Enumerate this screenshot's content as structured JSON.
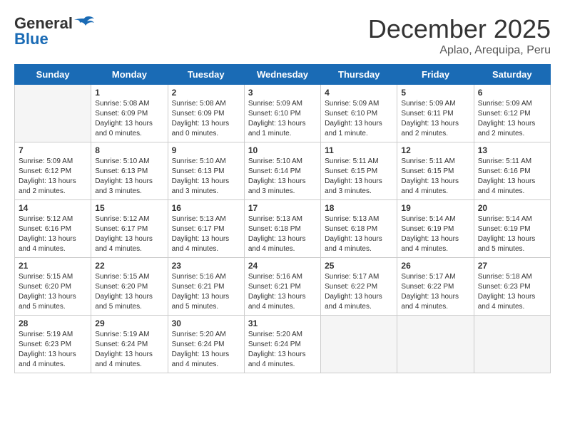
{
  "header": {
    "logo_general": "General",
    "logo_blue": "Blue",
    "month": "December 2025",
    "location": "Aplao, Arequipa, Peru"
  },
  "days_of_week": [
    "Sunday",
    "Monday",
    "Tuesday",
    "Wednesday",
    "Thursday",
    "Friday",
    "Saturday"
  ],
  "weeks": [
    [
      {
        "day": "",
        "sunrise": "",
        "sunset": "",
        "daylight": "",
        "empty": true
      },
      {
        "day": "1",
        "sunrise": "Sunrise: 5:08 AM",
        "sunset": "Sunset: 6:09 PM",
        "daylight": "Daylight: 13 hours and 0 minutes."
      },
      {
        "day": "2",
        "sunrise": "Sunrise: 5:08 AM",
        "sunset": "Sunset: 6:09 PM",
        "daylight": "Daylight: 13 hours and 0 minutes."
      },
      {
        "day": "3",
        "sunrise": "Sunrise: 5:09 AM",
        "sunset": "Sunset: 6:10 PM",
        "daylight": "Daylight: 13 hours and 1 minute."
      },
      {
        "day": "4",
        "sunrise": "Sunrise: 5:09 AM",
        "sunset": "Sunset: 6:10 PM",
        "daylight": "Daylight: 13 hours and 1 minute."
      },
      {
        "day": "5",
        "sunrise": "Sunrise: 5:09 AM",
        "sunset": "Sunset: 6:11 PM",
        "daylight": "Daylight: 13 hours and 2 minutes."
      },
      {
        "day": "6",
        "sunrise": "Sunrise: 5:09 AM",
        "sunset": "Sunset: 6:12 PM",
        "daylight": "Daylight: 13 hours and 2 minutes."
      }
    ],
    [
      {
        "day": "7",
        "sunrise": "Sunrise: 5:09 AM",
        "sunset": "Sunset: 6:12 PM",
        "daylight": "Daylight: 13 hours and 2 minutes."
      },
      {
        "day": "8",
        "sunrise": "Sunrise: 5:10 AM",
        "sunset": "Sunset: 6:13 PM",
        "daylight": "Daylight: 13 hours and 3 minutes."
      },
      {
        "day": "9",
        "sunrise": "Sunrise: 5:10 AM",
        "sunset": "Sunset: 6:13 PM",
        "daylight": "Daylight: 13 hours and 3 minutes."
      },
      {
        "day": "10",
        "sunrise": "Sunrise: 5:10 AM",
        "sunset": "Sunset: 6:14 PM",
        "daylight": "Daylight: 13 hours and 3 minutes."
      },
      {
        "day": "11",
        "sunrise": "Sunrise: 5:11 AM",
        "sunset": "Sunset: 6:15 PM",
        "daylight": "Daylight: 13 hours and 3 minutes."
      },
      {
        "day": "12",
        "sunrise": "Sunrise: 5:11 AM",
        "sunset": "Sunset: 6:15 PM",
        "daylight": "Daylight: 13 hours and 4 minutes."
      },
      {
        "day": "13",
        "sunrise": "Sunrise: 5:11 AM",
        "sunset": "Sunset: 6:16 PM",
        "daylight": "Daylight: 13 hours and 4 minutes."
      }
    ],
    [
      {
        "day": "14",
        "sunrise": "Sunrise: 5:12 AM",
        "sunset": "Sunset: 6:16 PM",
        "daylight": "Daylight: 13 hours and 4 minutes."
      },
      {
        "day": "15",
        "sunrise": "Sunrise: 5:12 AM",
        "sunset": "Sunset: 6:17 PM",
        "daylight": "Daylight: 13 hours and 4 minutes."
      },
      {
        "day": "16",
        "sunrise": "Sunrise: 5:13 AM",
        "sunset": "Sunset: 6:17 PM",
        "daylight": "Daylight: 13 hours and 4 minutes."
      },
      {
        "day": "17",
        "sunrise": "Sunrise: 5:13 AM",
        "sunset": "Sunset: 6:18 PM",
        "daylight": "Daylight: 13 hours and 4 minutes."
      },
      {
        "day": "18",
        "sunrise": "Sunrise: 5:13 AM",
        "sunset": "Sunset: 6:18 PM",
        "daylight": "Daylight: 13 hours and 4 minutes."
      },
      {
        "day": "19",
        "sunrise": "Sunrise: 5:14 AM",
        "sunset": "Sunset: 6:19 PM",
        "daylight": "Daylight: 13 hours and 4 minutes."
      },
      {
        "day": "20",
        "sunrise": "Sunrise: 5:14 AM",
        "sunset": "Sunset: 6:19 PM",
        "daylight": "Daylight: 13 hours and 5 minutes."
      }
    ],
    [
      {
        "day": "21",
        "sunrise": "Sunrise: 5:15 AM",
        "sunset": "Sunset: 6:20 PM",
        "daylight": "Daylight: 13 hours and 5 minutes."
      },
      {
        "day": "22",
        "sunrise": "Sunrise: 5:15 AM",
        "sunset": "Sunset: 6:20 PM",
        "daylight": "Daylight: 13 hours and 5 minutes."
      },
      {
        "day": "23",
        "sunrise": "Sunrise: 5:16 AM",
        "sunset": "Sunset: 6:21 PM",
        "daylight": "Daylight: 13 hours and 5 minutes."
      },
      {
        "day": "24",
        "sunrise": "Sunrise: 5:16 AM",
        "sunset": "Sunset: 6:21 PM",
        "daylight": "Daylight: 13 hours and 4 minutes."
      },
      {
        "day": "25",
        "sunrise": "Sunrise: 5:17 AM",
        "sunset": "Sunset: 6:22 PM",
        "daylight": "Daylight: 13 hours and 4 minutes."
      },
      {
        "day": "26",
        "sunrise": "Sunrise: 5:17 AM",
        "sunset": "Sunset: 6:22 PM",
        "daylight": "Daylight: 13 hours and 4 minutes."
      },
      {
        "day": "27",
        "sunrise": "Sunrise: 5:18 AM",
        "sunset": "Sunset: 6:23 PM",
        "daylight": "Daylight: 13 hours and 4 minutes."
      }
    ],
    [
      {
        "day": "28",
        "sunrise": "Sunrise: 5:19 AM",
        "sunset": "Sunset: 6:23 PM",
        "daylight": "Daylight: 13 hours and 4 minutes."
      },
      {
        "day": "29",
        "sunrise": "Sunrise: 5:19 AM",
        "sunset": "Sunset: 6:24 PM",
        "daylight": "Daylight: 13 hours and 4 minutes."
      },
      {
        "day": "30",
        "sunrise": "Sunrise: 5:20 AM",
        "sunset": "Sunset: 6:24 PM",
        "daylight": "Daylight: 13 hours and 4 minutes."
      },
      {
        "day": "31",
        "sunrise": "Sunrise: 5:20 AM",
        "sunset": "Sunset: 6:24 PM",
        "daylight": "Daylight: 13 hours and 4 minutes."
      },
      {
        "day": "",
        "sunrise": "",
        "sunset": "",
        "daylight": "",
        "empty": true
      },
      {
        "day": "",
        "sunrise": "",
        "sunset": "",
        "daylight": "",
        "empty": true
      },
      {
        "day": "",
        "sunrise": "",
        "sunset": "",
        "daylight": "",
        "empty": true
      }
    ]
  ]
}
